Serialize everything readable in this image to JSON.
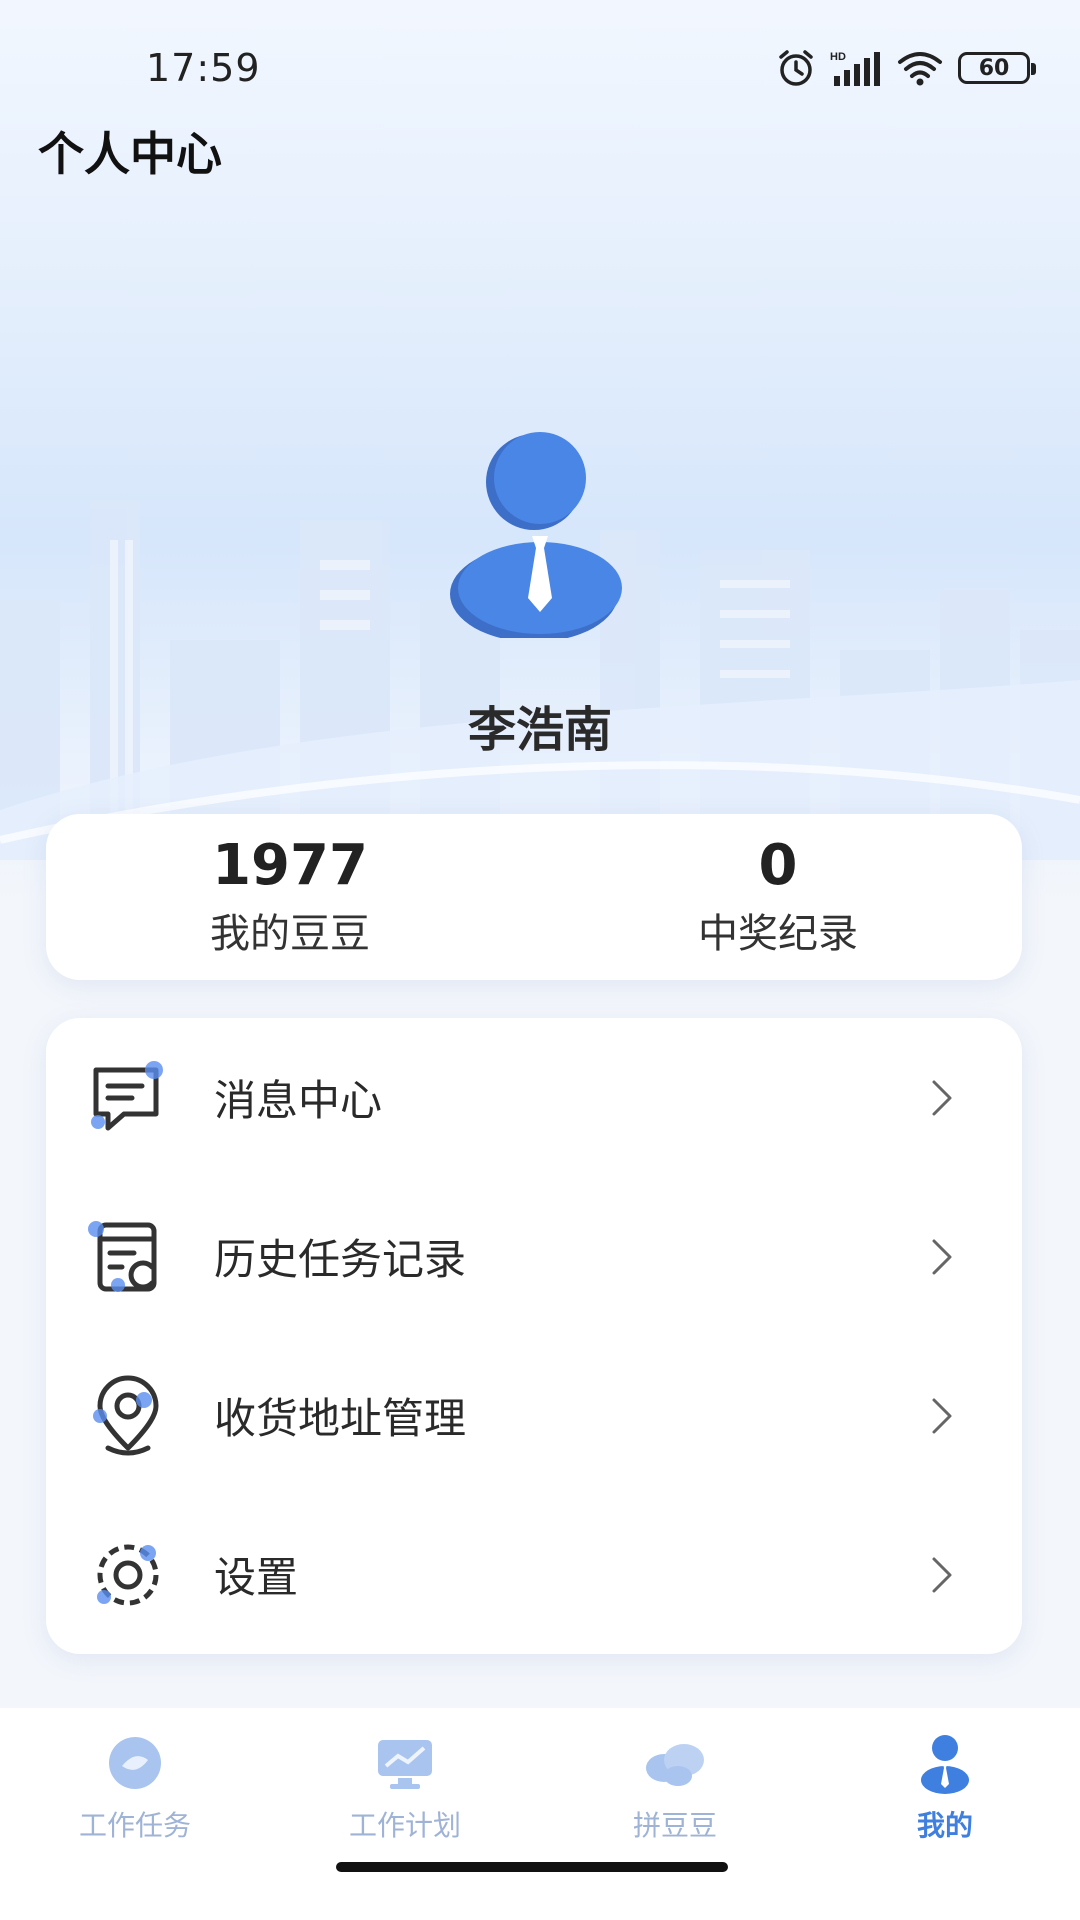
{
  "status_bar": {
    "time": "17:59",
    "battery": "60",
    "icons": [
      "alarm-icon",
      "hd-signal-icon",
      "wifi-icon",
      "battery-icon"
    ]
  },
  "header": {
    "title": "个人中心"
  },
  "profile": {
    "name": "李浩南",
    "avatar_icon": "user-avatar-icon"
  },
  "stats": [
    {
      "value": "1977",
      "label": "我的豆豆"
    },
    {
      "value": "0",
      "label": "中奖纪录"
    }
  ],
  "menu": [
    {
      "label": "消息中心",
      "icon": "message-icon"
    },
    {
      "label": "历史任务记录",
      "icon": "history-icon"
    },
    {
      "label": "收货地址管理",
      "icon": "location-icon"
    },
    {
      "label": "设置",
      "icon": "gear-icon"
    }
  ],
  "nav": [
    {
      "label": "工作任务",
      "icon": "task-icon",
      "active": false
    },
    {
      "label": "工作计划",
      "icon": "plan-icon",
      "active": false
    },
    {
      "label": "拼豆豆",
      "icon": "beans-icon",
      "active": false
    },
    {
      "label": "我的",
      "icon": "profile-icon",
      "active": true
    }
  ],
  "colors": {
    "accent": "#3f7fe0",
    "nav_inactive": "#9fb3d6",
    "icon_dot": "#5a8ef0"
  }
}
